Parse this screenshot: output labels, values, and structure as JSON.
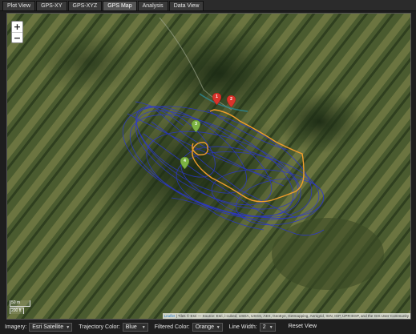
{
  "tabs": [
    {
      "label": "Plot View",
      "active": false
    },
    {
      "label": "GPS-XY",
      "active": false
    },
    {
      "label": "GPS-XYZ",
      "active": false
    },
    {
      "label": "GPS Map",
      "active": true
    },
    {
      "label": "Analysis",
      "active": false
    },
    {
      "label": "Data View",
      "active": false
    }
  ],
  "map": {
    "zoom_in": "+",
    "zoom_out": "−",
    "scale_metric": "50 m",
    "scale_imperial": "200 ft",
    "attribution_link": "Leaflet",
    "attribution_text": " | Tiles © Esri — Source: Esri, i-cubed, USDA, USGS, AEX, GeoEye, Getmapping, Aerogrid, IGN, IGP, UPR-EGP, and the GIS User Community",
    "markers": [
      {
        "color": "#d9342b",
        "label": "1"
      },
      {
        "color": "#d9342b",
        "label": "2"
      },
      {
        "color": "#7cb342",
        "label": "3"
      },
      {
        "color": "#7cb342",
        "label": "4"
      }
    ],
    "trajectory_color": "#2a35d6",
    "filtered_color": "#f29d2b"
  },
  "toolbar": {
    "imagery_label": "Imagery:",
    "imagery_value": "Esri Satellite",
    "trajectory_label": "Trajectory Color:",
    "trajectory_value": "Blue",
    "filtered_label": "Filtered Color:",
    "filtered_value": "Orange",
    "linewidth_label": "Line Width:",
    "linewidth_value": "2",
    "reset_label": "Reset View"
  }
}
